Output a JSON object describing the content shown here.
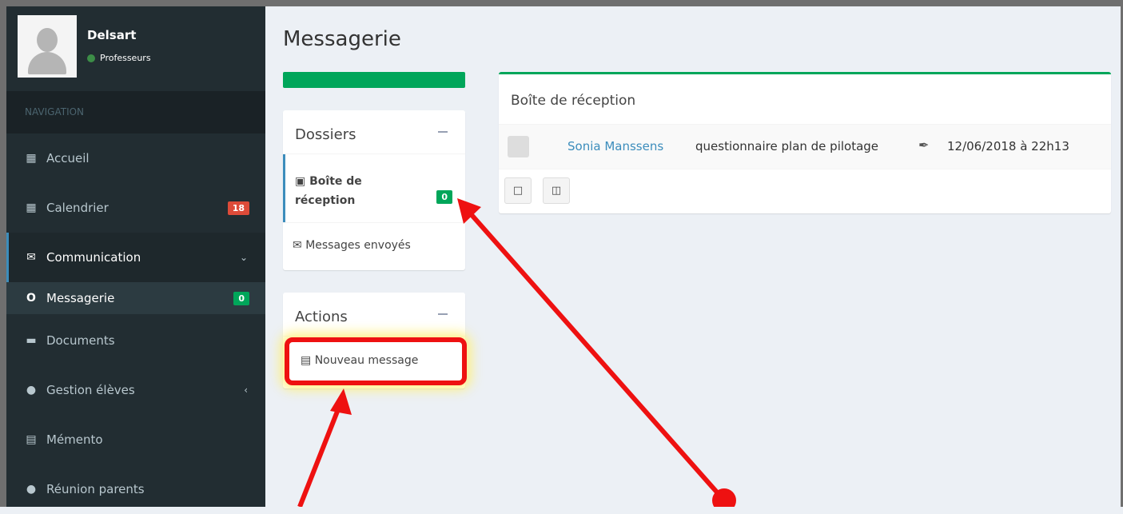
{
  "user": {
    "name": "Delsart",
    "role": "Professeurs"
  },
  "nav": {
    "header": "NAVIGATION",
    "items": [
      {
        "label": "Accueil",
        "icon": "grid-icon"
      },
      {
        "label": "Calendrier",
        "icon": "calendar-icon",
        "badge": "18"
      },
      {
        "label": "Communication",
        "icon": "envelope-icon"
      },
      {
        "label": "Messagerie",
        "icon": "circle-icon",
        "badge": "0"
      },
      {
        "label": "Documents",
        "icon": "folder-icon"
      },
      {
        "label": "Gestion élèves",
        "icon": "user-icon"
      },
      {
        "label": "Mémento",
        "icon": "copy-icon"
      },
      {
        "label": "Réunion parents",
        "icon": "users-icon"
      }
    ]
  },
  "page": {
    "title": "Messagerie"
  },
  "folders": {
    "title": "Dossiers",
    "inbox_line1": "Boîte de",
    "inbox_line2": "réception",
    "inbox_badge": "0",
    "sent": "Messages envoyés"
  },
  "actions": {
    "title": "Actions",
    "new_message": "Nouveau message"
  },
  "inbox": {
    "title": "Boîte de réception",
    "messages": [
      {
        "from": "Sonia Manssens",
        "subject": "questionnaire plan de pilotage",
        "date": "12/06/2018 à 22h13"
      }
    ]
  },
  "colors": {
    "sidebar": "#222d32",
    "accent_green": "#00a65a",
    "badge_red": "#dd4b39",
    "link_blue": "#3c8dbc",
    "annotation_red": "#ee1111"
  }
}
